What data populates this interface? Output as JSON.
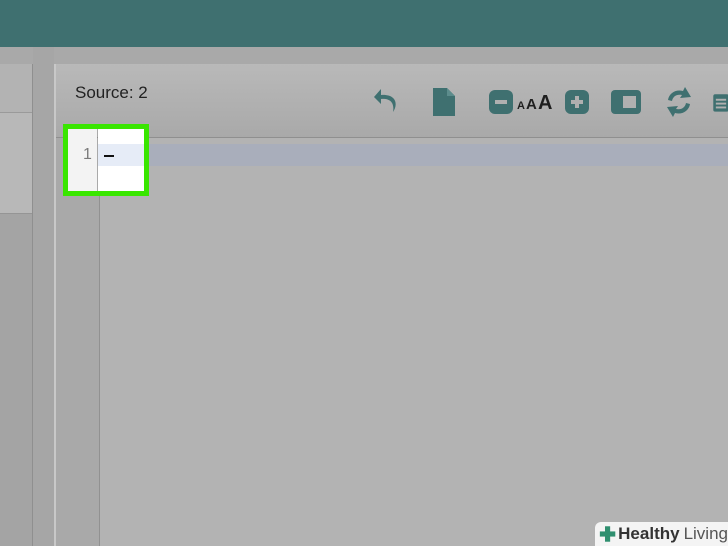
{
  "editor": {
    "source_label": "Source: 2",
    "line_number": "1",
    "toolbar": {
      "font_size_label": "AAA",
      "icons": [
        "undo-icon",
        "new-document-icon",
        "zoom-out-icon",
        "font-size-icon",
        "zoom-in-icon",
        "wrap-icon",
        "refresh-icon",
        "clipboard-icon"
      ]
    }
  },
  "watermark": {
    "brand": "Healthy",
    "brand2": "Living"
  },
  "colors": {
    "topbar": "#3f7070",
    "icon": "#3f7070",
    "highlight": "#39e600"
  }
}
